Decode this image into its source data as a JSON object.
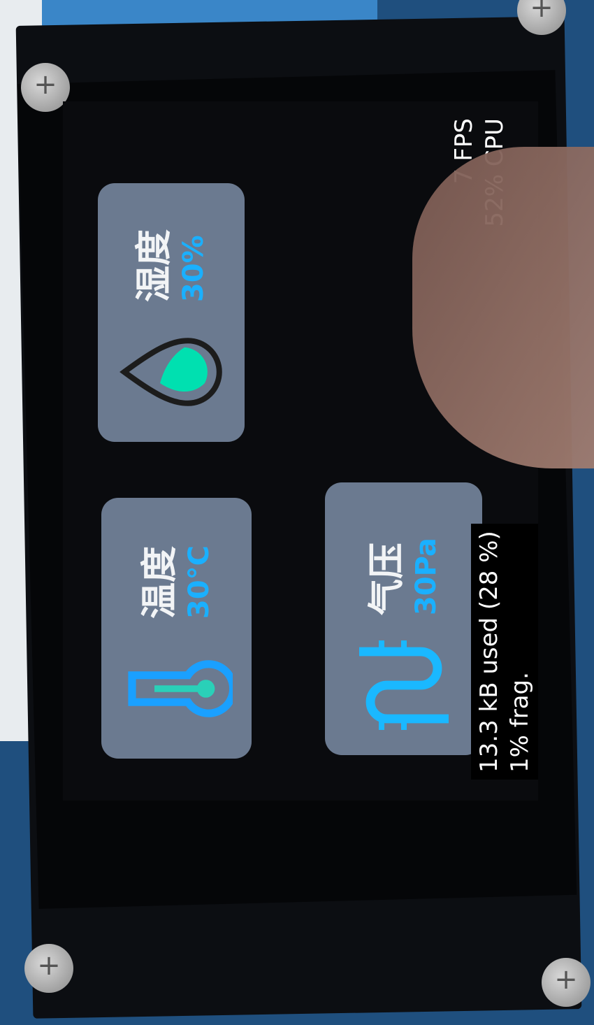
{
  "cards": [
    {
      "id": "humidity",
      "title": "湿度",
      "value": "30%",
      "icon": "humidity-drop-icon",
      "icon_color": "#00e0b0"
    },
    {
      "id": "temperature",
      "title": "温度",
      "value": "30°C",
      "icon": "thermometer-icon",
      "icon_color": "#1aa0ff"
    },
    {
      "id": "pressure",
      "title": "气压",
      "value": "30Pa",
      "icon": "pressure-icon",
      "icon_color": "#1ab8ff"
    }
  ],
  "perf": {
    "fps": "7 FPS",
    "cpu": "52% CPU"
  },
  "mem": {
    "used": "13.3 kB used (28 %)",
    "frag": "1% frag."
  },
  "colors": {
    "card_bg": "#6b7a90",
    "accent": "#1ab0ff",
    "screen_bg": "#0a0b0e"
  }
}
